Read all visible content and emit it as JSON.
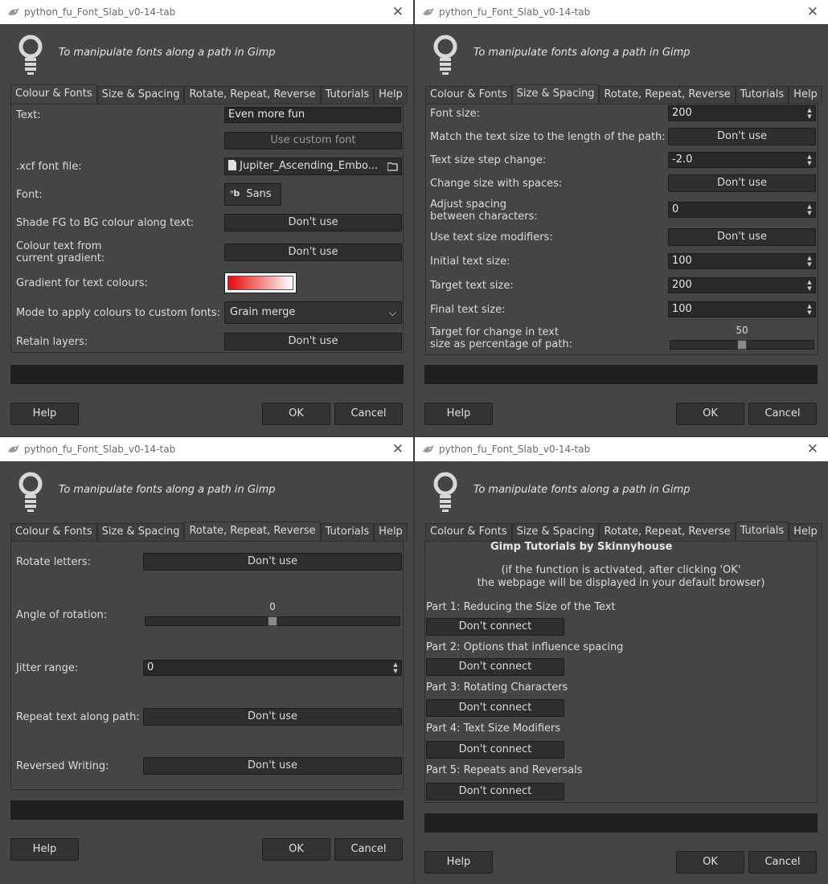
{
  "window_title": "python_fu_Font_Slab_v0-14-tab",
  "close_glyph": "✕",
  "subtitle": "To manipulate fonts along a path in Gimp",
  "tabs": [
    "Colour & Fonts",
    "Size & Spacing",
    "Rotate, Repeat, Reverse",
    "Tutorials",
    "Help"
  ],
  "buttons": {
    "help": "Help",
    "ok": "OK",
    "cancel": "Cancel"
  },
  "colour_fonts": {
    "text_label": "Text:",
    "text_value": "Even more fun",
    "custom_font_button": "Use custom font",
    "xcf_label": ".xcf font file:",
    "xcf_value": "Jupiter_Ascending_Embo...",
    "font_label": "Font:",
    "font_value": "Sans",
    "shade_label": "Shade FG to BG colour along text:",
    "shade_value": "Don't use",
    "colour_gradient_label_1": "Colour text from",
    "colour_gradient_label_2": "current gradient:",
    "colour_gradient_value": "Don't use",
    "gradient_label": "Gradient for text colours:",
    "gradient_colors": [
      "#e30a0a",
      "#ffffff"
    ],
    "mode_label": "Mode to apply colours to custom fonts:",
    "mode_value": "Grain merge",
    "retain_label": "Retain layers:",
    "retain_value": "Don't use"
  },
  "size_spacing": {
    "font_size_label": "Font size:",
    "font_size_value": "200",
    "match_label": "Match the text size to the length of the path:",
    "match_value": "Don't use",
    "step_label": "Text size step change:",
    "step_value": "-2.0",
    "spaces_label": "Change size with spaces:",
    "spaces_value": "Don't use",
    "adjust_label_1": "Adjust spacing",
    "adjust_label_2": "between characters:",
    "adjust_value": "0",
    "modifiers_label": "Use text size modifiers:",
    "modifiers_value": "Don't use",
    "initial_label": "Initial text size:",
    "initial_value": "100",
    "target_label": "Target text size:",
    "target_value": "200",
    "final_label": "Final text size:",
    "final_value": "100",
    "pct_label_1": "Target for change in text",
    "pct_label_2": "size as percentage of path:",
    "pct_value": "50",
    "pct_fraction": 0.5
  },
  "rotate": {
    "rotate_label": "Rotate letters:",
    "rotate_value": "Don't use",
    "angle_label": "Angle of rotation:",
    "angle_value": "0",
    "angle_fraction": 0.5,
    "jitter_label": "Jitter range:",
    "jitter_value": "0",
    "repeat_label": "Repeat text along path:",
    "repeat_value": "Don't use",
    "reversed_label": "Reversed Writing:",
    "reversed_value": "Don't use"
  },
  "tutorials": {
    "title": "Gimp Tutorials by Skinnyhouse",
    "note_1": "(if the function is activated, after clicking 'OK'",
    "note_2": "the webpage will be displayed in your default browser)",
    "parts": [
      {
        "label": "Part 1: Reducing the Size of the Text",
        "button": "Don't connect"
      },
      {
        "label": "Part 2: Options that influence spacing",
        "button": "Don't connect"
      },
      {
        "label": "Part 3: Rotating Characters",
        "button": "Don't connect"
      },
      {
        "label": "Part 4: Text Size Modifiers",
        "button": "Don't connect"
      },
      {
        "label": "Part 5: Repeats and Reversals",
        "button": "Don't connect"
      }
    ]
  }
}
